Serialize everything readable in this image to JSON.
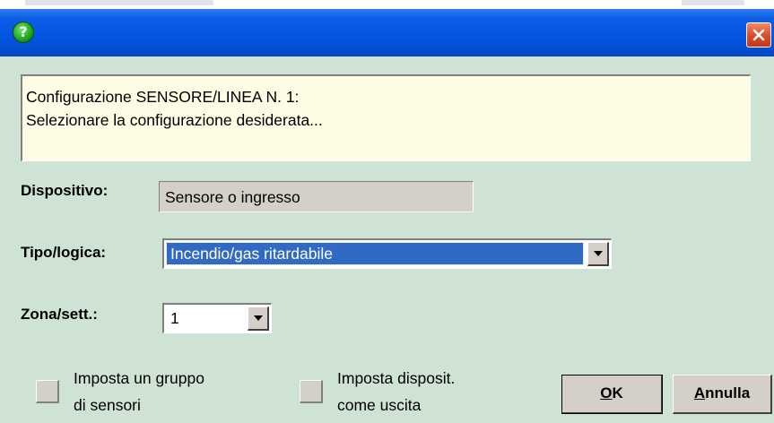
{
  "dialog": {
    "title_bar": {
      "help_icon_glyph": "?",
      "help_icon": "question-circle-icon",
      "close_icon": "close-x-icon",
      "accent_color": "#0355e0"
    },
    "message": {
      "line1": "Configurazione SENSORE/LINEA N.   1:",
      "line2": "Selezionare la configurazione desiderata..."
    },
    "fields": {
      "dispositivo": {
        "label": "Dispositivo:",
        "value": "Sensore o ingresso"
      },
      "tipo_logica": {
        "label": "Tipo/logica:",
        "selected": "Incendio/gas ritardabile"
      },
      "zona_sett": {
        "label": "Zona/sett.:",
        "selected": "1"
      }
    },
    "checkboxes": {
      "gruppo": {
        "label_line1": "Imposta un gruppo",
        "label_line2": "di sensori",
        "checked": false
      },
      "uscita": {
        "label_line1": "Imposta disposit.",
        "label_line2": "come uscita",
        "checked": false
      }
    },
    "buttons": {
      "ok": {
        "mnemonic": "O",
        "rest": "K"
      },
      "annulla": {
        "mnemonic": "A",
        "rest": "nnulla"
      }
    }
  }
}
